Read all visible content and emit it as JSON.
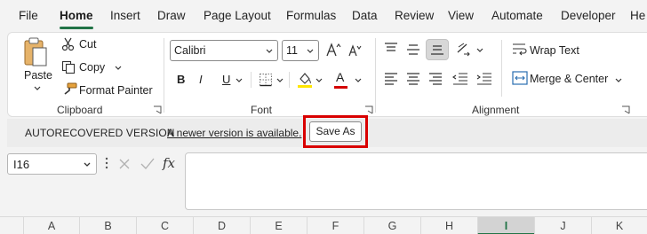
{
  "menu": {
    "tabs": [
      "File",
      "Home",
      "Insert",
      "Draw",
      "Page Layout",
      "Formulas",
      "Data",
      "Review",
      "View",
      "Automate",
      "Developer",
      "He"
    ],
    "active": "Home"
  },
  "ribbon": {
    "clipboard": {
      "label": "Clipboard",
      "paste": "Paste",
      "cut": "Cut",
      "copy": "Copy",
      "format_painter": "Format Painter"
    },
    "font": {
      "label": "Font",
      "font_name": "Calibri",
      "font_size": "11",
      "bold": "B",
      "italic": "I",
      "underline": "U",
      "font_color_letter": "A",
      "highlight_color": "#ffe600",
      "font_color": "#d40000"
    },
    "alignment": {
      "label": "Alignment",
      "wrap_text": "Wrap Text",
      "merge_center": "Merge & Center"
    }
  },
  "notice": {
    "title": "AUTORECOVERED VERSION",
    "message": "A newer version is available.",
    "save_as": "Save As"
  },
  "formula_bar": {
    "name_box": "I16",
    "fx": "fx",
    "formula": ""
  },
  "columns": {
    "headers": [
      "A",
      "B",
      "C",
      "D",
      "E",
      "F",
      "G",
      "H",
      "I",
      "J",
      "K"
    ],
    "selected": "I"
  },
  "colors": {
    "accent": "#217346",
    "highlight_box": "#d90000"
  }
}
